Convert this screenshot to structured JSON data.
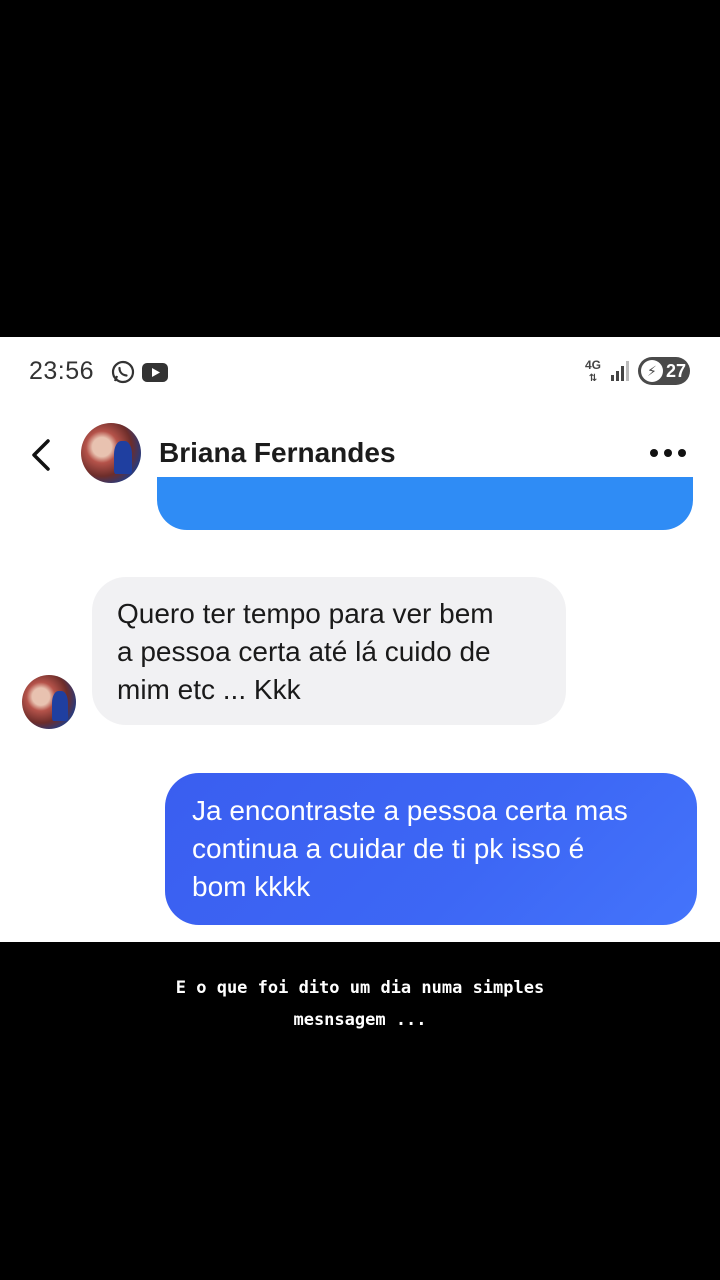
{
  "status_bar": {
    "time": "23:56",
    "network": "4G",
    "battery": "27",
    "icons": [
      "whatsapp-icon",
      "youtube-icon",
      "signal-icon"
    ]
  },
  "chat": {
    "contact_name": "Briana Fernandes",
    "received_message": "Quero  ter tempo para ver bem\na pessoa certa  até lá cuido de\nmim etc ... Kkk",
    "sent_message": "Ja encontraste a pessoa certa mas\ncontinua a cuidar de ti pk isso é\nbom kkkk"
  },
  "caption": {
    "text": "E o que foi dito um dia  numa simples\nmesnsagem ..."
  },
  "colors": {
    "sent_bubble": "#3d67f5",
    "partial_bubble": "#2f8cf5",
    "received_bubble": "#f1f1f3"
  }
}
